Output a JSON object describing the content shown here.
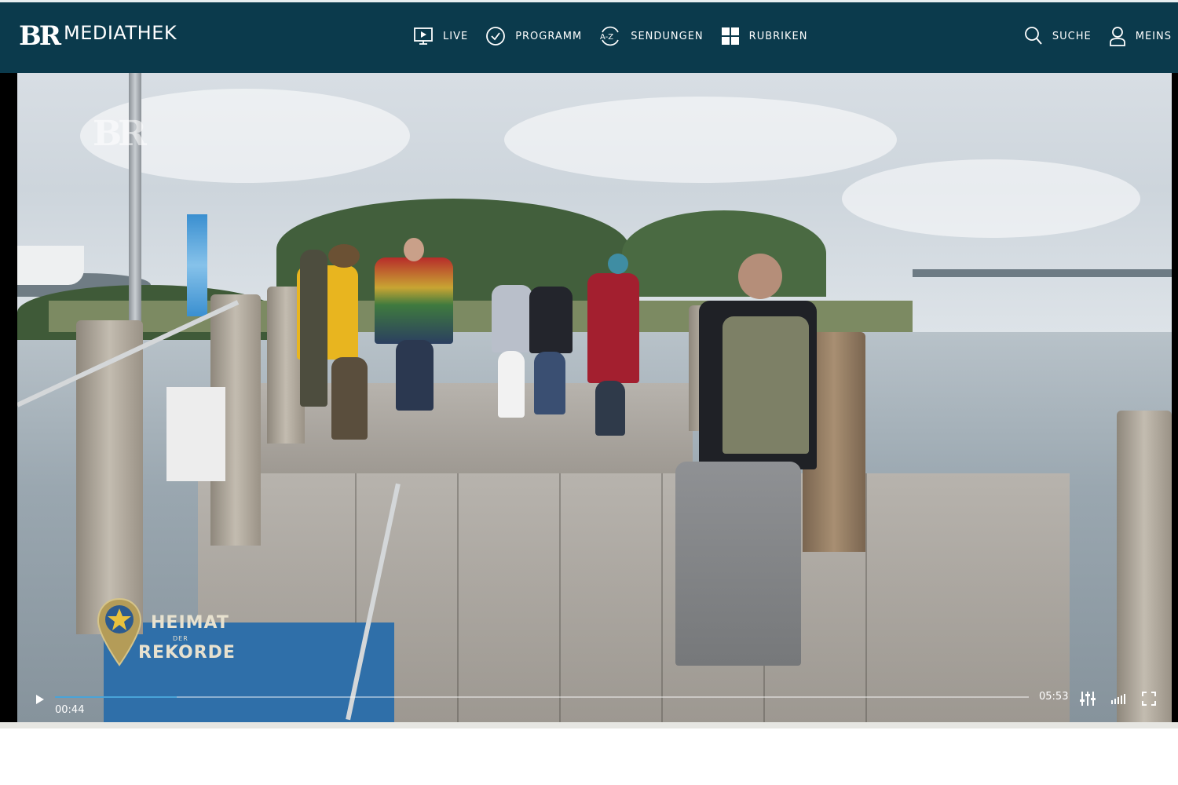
{
  "brand": {
    "logo_letters": "BR",
    "name": "MEDIATHEK"
  },
  "nav": {
    "items": [
      {
        "label": "LIVE",
        "icon": "tv-play-icon"
      },
      {
        "label": "PROGRAMM",
        "icon": "clock-icon"
      },
      {
        "label": "SENDUNGEN",
        "icon": "a-z-icon"
      },
      {
        "label": "RUBRIKEN",
        "icon": "grid-icon"
      }
    ],
    "right": [
      {
        "label": "SUCHE",
        "icon": "search-icon"
      },
      {
        "label": "MEINS",
        "icon": "user-icon"
      }
    ]
  },
  "player": {
    "watermark": "BR",
    "show_logo": {
      "line1": "HEIMAT",
      "line2": "DER",
      "line3": "REKORDE"
    },
    "current_time": "00:44",
    "duration": "05:53",
    "progress_fraction": 0.125,
    "colors": {
      "header": "#0b3a4c",
      "progress": "#49a3d8"
    }
  }
}
